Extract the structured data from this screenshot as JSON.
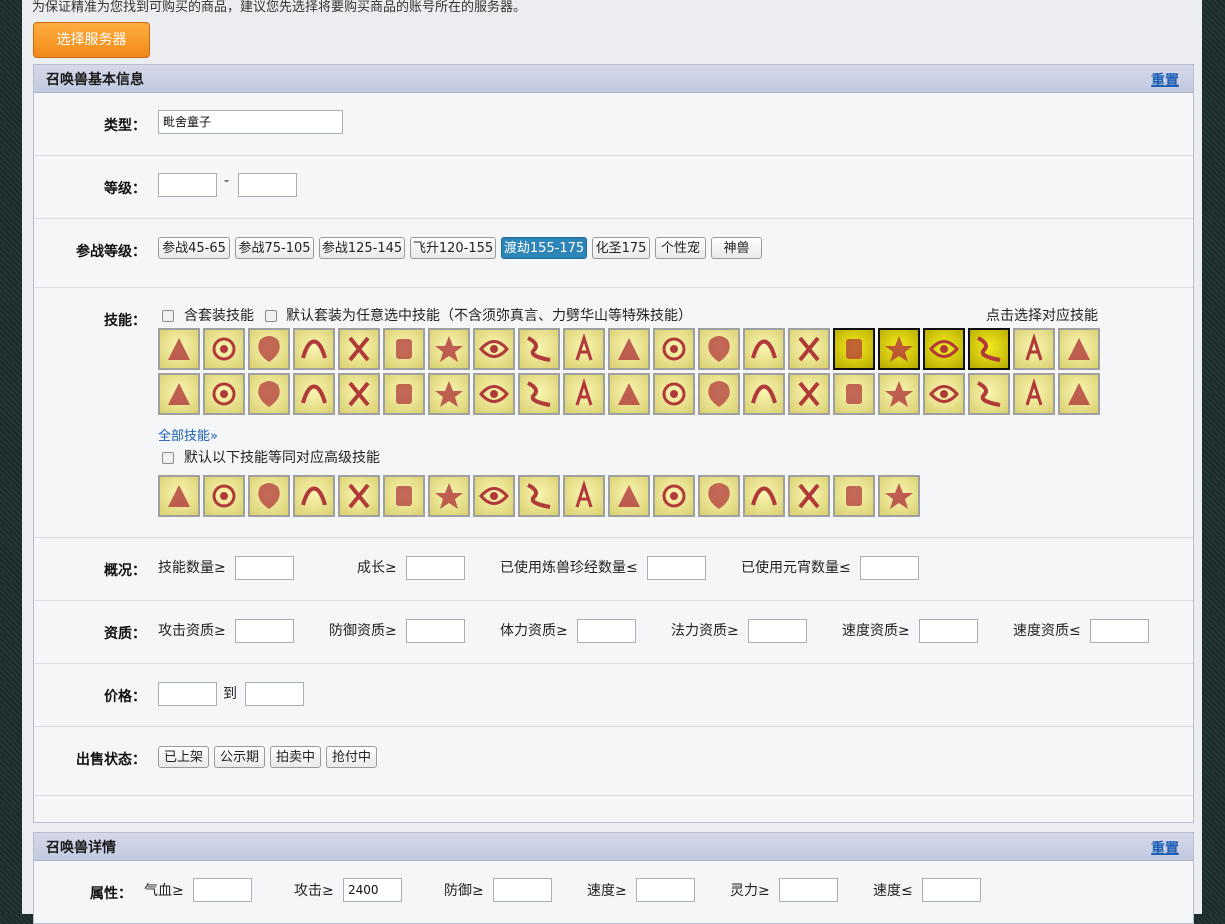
{
  "top": {
    "notice": "为保证精准为您找到可购买的商品，建议您先选择将要购买商品的账号所在的服务器。",
    "server_button": "选择服务器"
  },
  "basic_panel": {
    "title": "召唤兽基本信息",
    "reset": "重置",
    "type": {
      "label": "类型：",
      "value": "毗舍童子"
    },
    "level": {
      "label": "等级：",
      "dash": "-"
    },
    "battle_level": {
      "label": "参战等级：",
      "options": [
        "参战45-65",
        "参战75-105",
        "参战125-145",
        "飞升120-155",
        "渡劫155-175",
        "化圣175",
        "个性宠",
        "神兽"
      ],
      "active": "渡劫155-175"
    },
    "skills": {
      "label": "技能：",
      "include_suit": "含套装技能",
      "default_suit": "默认套装为任意选中技能（不含须弥真言、力劈华山等特殊技能）",
      "hint": "点击选择对应技能",
      "row1": [
        "skill-a",
        "skill-b",
        "skill-c",
        "skill-d",
        "skill-e",
        "skill-f",
        "skill-g",
        "skill-h",
        "skill-i",
        "skill-j",
        "skill-k",
        "skill-l",
        "skill-m",
        "skill-n",
        "skill-o",
        "skill-p",
        "skill-q",
        "skill-r",
        "skill-s",
        "skill-t",
        "skill-u"
      ],
      "row1_selected": [
        15,
        16,
        17,
        18
      ],
      "row2": [
        "skill-v",
        "skill-w",
        "skill-x",
        "skill-y",
        "skill-z",
        "skill-aa",
        "skill-ab",
        "skill-ac",
        "skill-ad",
        "skill-ae",
        "skill-af",
        "skill-ag",
        "skill-ah",
        "skill-ai",
        "skill-aj",
        "skill-ak",
        "skill-al",
        "skill-am",
        "skill-an",
        "skill-ao",
        "skill-ap"
      ],
      "all_skills": "全部技能»",
      "equivalent": "默认以下技能等同对应高级技能",
      "row3": [
        "skill-1",
        "skill-2",
        "skill-3",
        "skill-4",
        "skill-5",
        "skill-6",
        "skill-7",
        "skill-8",
        "skill-9",
        "skill-10",
        "skill-11",
        "skill-12",
        "skill-13",
        "skill-14",
        "skill-15",
        "skill-16",
        "skill-17"
      ]
    },
    "overview": {
      "label": "概况：",
      "skill_count": "技能数量≥",
      "growth": "成长≥",
      "used_jingjing": "已使用炼兽珍经数量≤",
      "used_yuanxiao": "已使用元宵数量≤"
    },
    "aptitude": {
      "label": "资质：",
      "attack": "攻击资质≥",
      "defense": "防御资质≥",
      "hp": "体力资质≥",
      "magic": "法力资质≥",
      "speed_min": "速度资质≥",
      "speed_max": "速度资质≤"
    },
    "price": {
      "label": "价格：",
      "to": "到"
    },
    "sale_status": {
      "label": "出售状态：",
      "options": [
        "已上架",
        "公示期",
        "拍卖中",
        "抢付中"
      ]
    }
  },
  "detail_panel": {
    "title": "召唤兽详情",
    "reset": "重置",
    "attributes": {
      "label": "属性：",
      "hp": "气血≥",
      "attack": "攻击≥",
      "attack_value": "2400",
      "defense": "防御≥",
      "speed_min": "速度≥",
      "spirit": "灵力≥",
      "speed_max": "速度≤"
    }
  }
}
